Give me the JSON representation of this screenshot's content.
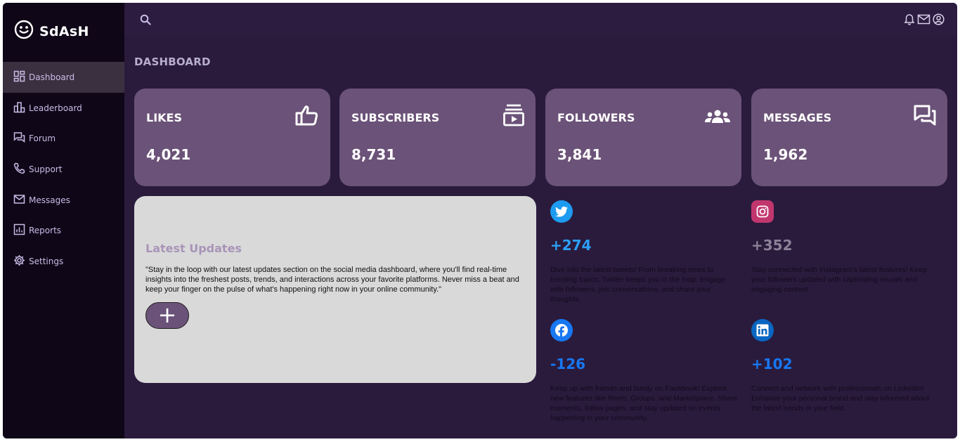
{
  "brand": {
    "title": "SdAsH",
    "icon": "smiley-icon"
  },
  "sidebar": {
    "items": [
      {
        "label": "Dashboard",
        "icon": "dashboard-icon",
        "active": true
      },
      {
        "label": "Leaderboard",
        "icon": "leaderboard-icon"
      },
      {
        "label": "Forum",
        "icon": "forum-icon"
      },
      {
        "label": "Support",
        "icon": "phone-icon"
      },
      {
        "label": "Messages",
        "icon": "mail-icon"
      },
      {
        "label": "Reports",
        "icon": "reports-icon"
      },
      {
        "label": "Settings",
        "icon": "gear-icon"
      }
    ]
  },
  "topbar": {
    "icons": [
      "search-icon",
      "bell-icon",
      "mail-icon",
      "user-circle-icon"
    ]
  },
  "page": {
    "title": "DASHBOARD"
  },
  "stats": [
    {
      "label": "LIKES",
      "value": "4,021",
      "icon": "thumbs-up-icon"
    },
    {
      "label": "SUBSCRIBERS",
      "value": "8,731",
      "icon": "subscriptions-icon"
    },
    {
      "label": "FOLLOWERS",
      "value": "3,841",
      "icon": "users-icon"
    },
    {
      "label": "MESSAGES",
      "value": "1,962",
      "icon": "chat-icon"
    }
  ],
  "updates": {
    "title": "Latest Updates",
    "text": "\"Stay in the loop with our latest updates section on the social media dashboard, where you'll find real-time insights into the freshest posts, trends, and interactions across your favorite platforms. Never miss a beat and keep your finger on the pulse of what's happening right now in your online community.\"",
    "button_label": "+"
  },
  "social": [
    {
      "network": "twitter",
      "icon": "twitter-icon",
      "count": "+274",
      "color": "#1d9bf0",
      "text": "Dive into the latest tweets! From breaking news to trending topics, Twitter keeps you in the loop. Engage with followers, join conversations, and share your thoughts."
    },
    {
      "network": "instagram",
      "icon": "instagram-icon",
      "count": "+352",
      "color": "#c13584",
      "text": "Stay connected with Instagram's latest features! Keep your followers updated with captivating visuals and engaging content."
    },
    {
      "network": "facebook",
      "icon": "facebook-icon",
      "count": "-126",
      "color": "#1877f2",
      "text": "Keep up with friends and family on Facebook! Explore new features like Reels, Groups, and Marketplace. Share moments, follow pages, and stay updated on events happening in your community."
    },
    {
      "network": "linkedin",
      "icon": "linkedin-icon",
      "count": "+102",
      "color": "#0a66c2",
      "text": "Connect and network with professionals on LinkedIn! Enhance your personal brand and stay informed about the latest trends in your field."
    }
  ],
  "colors": {
    "sidebar_bg": "#0f0617",
    "main_bg": "#2a1b3d",
    "card_bg": "#6b5278",
    "nav_text": "#c7bce6",
    "instagram_count": "#8d8198"
  }
}
